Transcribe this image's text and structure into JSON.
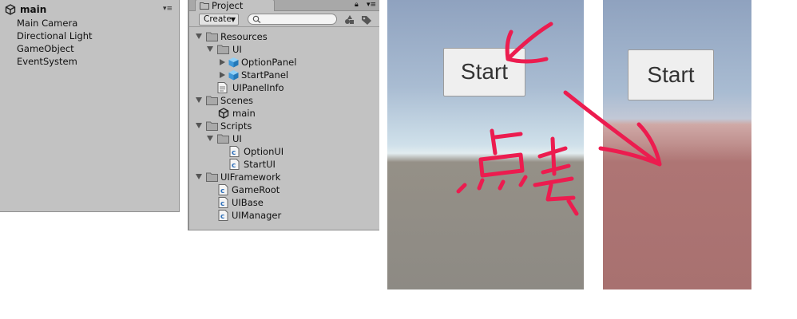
{
  "hierarchy": {
    "scene": "main",
    "items": [
      "Main Camera",
      "Directional Light",
      "GameObject",
      "EventSystem"
    ]
  },
  "project": {
    "tab": "Project",
    "create": "Create",
    "search": {
      "placeholder": ""
    },
    "tree": {
      "resources": "Resources",
      "resources_ui": "UI",
      "option_panel": "OptionPanel",
      "start_panel": "StartPanel",
      "ui_panel_info": "UIPanelInfo",
      "scenes": "Scenes",
      "scene_main": "main",
      "scripts": "Scripts",
      "scripts_ui": "UI",
      "option_ui": "OptionUI",
      "start_ui": "StartUI",
      "ui_framework": "UIFramework",
      "game_root": "GameRoot",
      "ui_base": "UIBase",
      "ui_manager": "UIManager"
    }
  },
  "game": {
    "button_1": "Start",
    "button_2": "Start"
  },
  "annotation_text": "点击",
  "colors": {
    "panel_bg": "#c2c2c2",
    "annotation": "#ec1c4f",
    "folder": "#a7a7a7",
    "prefab": "#4aa3e0"
  },
  "icons": [
    "unity-scene-icon",
    "folder-icon",
    "prefab-cube-icon",
    "text-asset-icon",
    "script-icon",
    "lock-icon",
    "menu-icon",
    "search-icon"
  ]
}
